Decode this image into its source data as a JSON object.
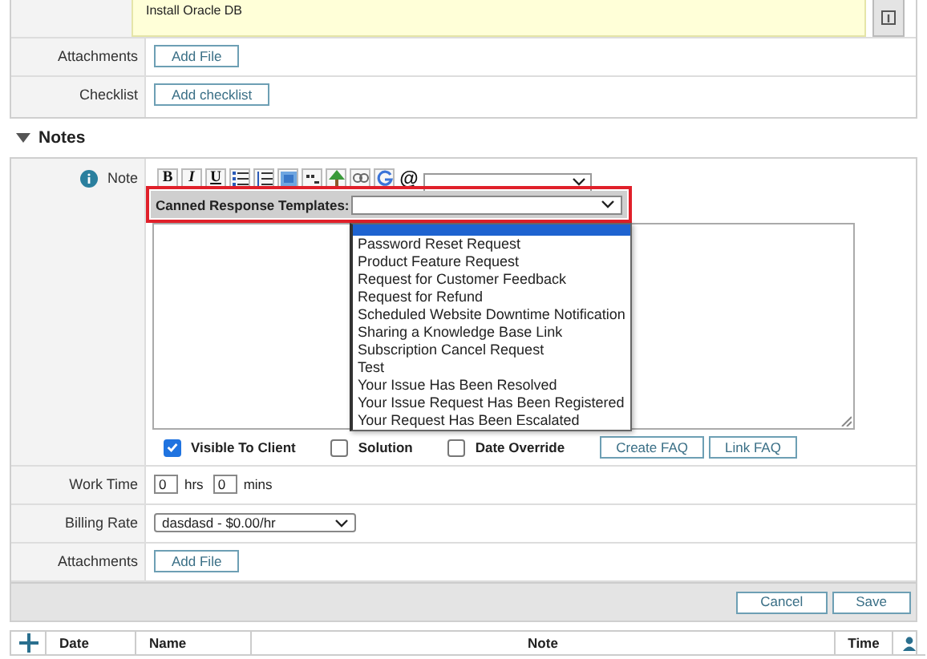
{
  "task": {
    "summary": "Install Oracle DB",
    "attachments_label": "Attachments",
    "attachments_button": "Add File",
    "checklist_label": "Checklist",
    "checklist_button": "Add checklist"
  },
  "notes": {
    "title": "Notes",
    "expanded": true,
    "note_label": "Note",
    "toolbar": [
      {
        "kind": "bold",
        "label": "B"
      },
      {
        "kind": "italic",
        "label": "I"
      },
      {
        "kind": "underline",
        "label": "U"
      },
      {
        "kind": "bullets"
      },
      {
        "kind": "numbered"
      },
      {
        "kind": "image"
      },
      {
        "kind": "superscript"
      },
      {
        "kind": "tree"
      },
      {
        "kind": "link"
      },
      {
        "kind": "google"
      },
      {
        "kind": "mention",
        "label": "@"
      }
    ],
    "canned_label": "Canned Response Templates:",
    "canned_options": [
      {
        "selected": true
      },
      {
        "label": "Password Reset Request",
        "selected": false
      },
      {
        "label": "Product Feature Request",
        "selected": false
      },
      {
        "label": "Request for Customer Feedback",
        "selected": false
      },
      {
        "label": "Request for Refund",
        "selected": false
      },
      {
        "label": "Scheduled Website Downtime Notification",
        "selected": false
      },
      {
        "label": "Sharing a Knowledge Base Link",
        "selected": false
      },
      {
        "label": "Subscription Cancel Request",
        "selected": false
      },
      {
        "label": "Test",
        "selected": false
      },
      {
        "label": "Your Issue Has Been Resolved",
        "selected": false
      },
      {
        "label": "Your Issue Request Has Been Registered",
        "selected": false
      },
      {
        "label": "Your Request Has Been Escalated",
        "selected": false
      }
    ],
    "options": [
      {
        "label": "Visible To Client",
        "checked": true
      },
      {
        "label": "Solution",
        "checked": false
      },
      {
        "label": "Date Override",
        "checked": false
      }
    ],
    "faq_buttons": [
      "Create FAQ",
      "Link FAQ"
    ],
    "work_time_label": "Work Time",
    "hours": "0",
    "hours_unit": "hrs",
    "minutes": "0",
    "minutes_unit": "mins",
    "billing_label": "Billing Rate",
    "billing_value": "dasdasd - $0.00/hr",
    "attachments_label": "Attachments",
    "attachments_button": "Add File",
    "buttons": [
      "Cancel",
      "Save"
    ]
  },
  "table": {
    "columns": [
      "Date",
      "Name",
      "Note",
      "Time"
    ]
  }
}
